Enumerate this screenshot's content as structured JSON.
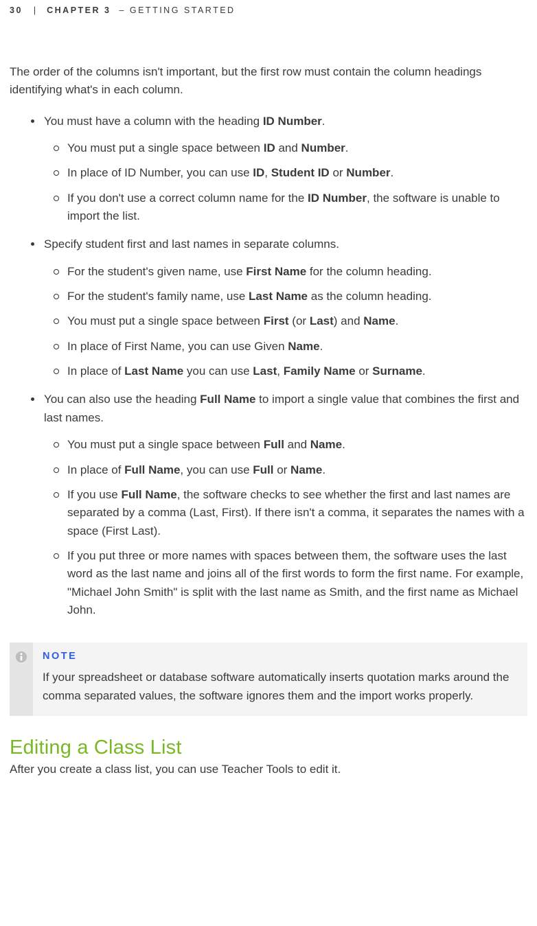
{
  "header": {
    "page_number": "30",
    "separator": "|",
    "chapter_label": "CHAPTER 3",
    "dash": "–",
    "chapter_title": "GETTING STARTED"
  },
  "intro": "The order of the columns isn't important, but the first row must contain the column headings identifying what's in each column.",
  "bullets": {
    "b1_text": "You must have a column with the heading ",
    "b1_bold1": "ID Number",
    "b1_tail": ".",
    "b1_sub1_a": "You must put a single space between ",
    "b1_sub1_bold1": "ID",
    "b1_sub1_b": " and ",
    "b1_sub1_bold2": "Number",
    "b1_sub1_c": ".",
    "b1_sub2_a": "In place of ID Number, you can use ",
    "b1_sub2_bold1": "ID",
    "b1_sub2_b": ", ",
    "b1_sub2_bold2": "Student ID",
    "b1_sub2_c": " or ",
    "b1_sub2_bold3": "Number",
    "b1_sub2_d": ".",
    "b1_sub3_a": "If you don't use a correct column name for the ",
    "b1_sub3_bold1": "ID Number",
    "b1_sub3_b": ", the software is unable to import the list.",
    "b2_text": "Specify student first and last names in separate columns.",
    "b2_sub1_a": "For the student's given name, use ",
    "b2_sub1_bold1": "First Name",
    "b2_sub1_b": " for the column heading.",
    "b2_sub2_a": "For the student's family name, use ",
    "b2_sub2_bold1": "Last Name",
    "b2_sub2_b": " as the column heading.",
    "b2_sub3_a": "You must put a single space between ",
    "b2_sub3_bold1": "First",
    "b2_sub3_b": " (or ",
    "b2_sub3_bold2": "Last",
    "b2_sub3_c": ") and ",
    "b2_sub3_bold3": "Name",
    "b2_sub3_d": ".",
    "b2_sub4_a": "In place of First Name, you can use Given ",
    "b2_sub4_bold1": "Name",
    "b2_sub4_b": ".",
    "b2_sub5_a": "In place of ",
    "b2_sub5_bold1": "Last Name",
    "b2_sub5_b": " you can use ",
    "b2_sub5_bold2": "Last",
    "b2_sub5_c": ", ",
    "b2_sub5_bold3": "Family Name",
    "b2_sub5_d": " or ",
    "b2_sub5_bold4": "Surname",
    "b2_sub5_e": ".",
    "b3_a": "You can also use the heading ",
    "b3_bold1": "Full Name",
    "b3_b": " to import a single value that combines the first and last names.",
    "b3_sub1_a": "You must put a single space between ",
    "b3_sub1_bold1": "Full",
    "b3_sub1_b": " and ",
    "b3_sub1_bold2": "Name",
    "b3_sub1_c": ".",
    "b3_sub2_a": "In place of ",
    "b3_sub2_bold1": "Full Name",
    "b3_sub2_b": ", you can use ",
    "b3_sub2_bold2": "Full",
    "b3_sub2_c": " or ",
    "b3_sub2_bold3": "Name",
    "b3_sub2_d": ".",
    "b3_sub3_a": "If you use ",
    "b3_sub3_bold1": "Full Name",
    "b3_sub3_b": ", the software checks to see whether the first and last names are separated by a comma (Last, First). If there isn't a comma, it separates the names with a space (First Last).",
    "b3_sub4": "If you put three or more names with spaces between them, the software uses the last word as the last name and joins all of the first words to form the first name. For example, \"Michael John Smith\" is split with the last name as Smith, and the first name as Michael John."
  },
  "note": {
    "label": "NOTE",
    "text": "If your spreadsheet or database software automatically inserts quotation marks around the comma separated values, the software ignores them and the import works properly."
  },
  "section": {
    "title": "Editing a Class List",
    "intro": "After you create a class list, you can use Teacher Tools to edit it."
  }
}
